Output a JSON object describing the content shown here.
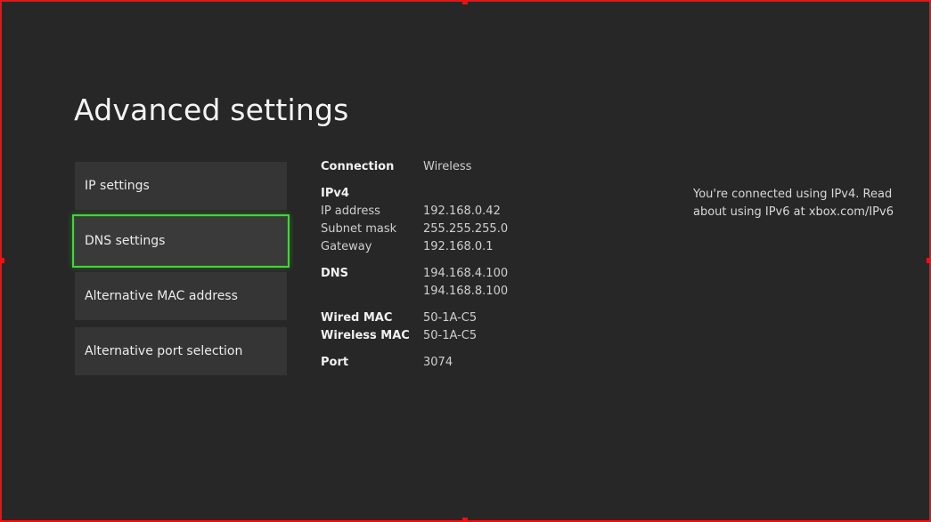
{
  "page": {
    "title": "Advanced settings"
  },
  "menu": {
    "items": [
      {
        "label": "IP settings"
      },
      {
        "label": "DNS settings"
      },
      {
        "label": "Alternative MAC address"
      },
      {
        "label": "Alternative port selection"
      }
    ],
    "focused_index": 1
  },
  "info": {
    "connection_label": "Connection",
    "connection_value": "Wireless",
    "ipv4_label": "IPv4",
    "ip_address_label": "IP address",
    "ip_address_value": "192.168.0.42",
    "subnet_mask_label": "Subnet mask",
    "subnet_mask_value": "255.255.255.0",
    "gateway_label": "Gateway",
    "gateway_value": "192.168.0.1",
    "dns_label": "DNS",
    "dns_primary": "194.168.4.100",
    "dns_secondary": "194.168.8.100",
    "wired_mac_label": "Wired MAC",
    "wired_mac_value": "50-1A-C5",
    "wireless_mac_label": "Wireless MAC",
    "wireless_mac_value": "50-1A-C5",
    "port_label": "Port",
    "port_value": "3074"
  },
  "note": {
    "text": "You're connected using IPv4. Read about using IPv6 at xbox.com/IPv6"
  },
  "colors": {
    "background": "#272727",
    "tile": "#353535",
    "focus": "#44d33a",
    "frame": "#ee1111"
  }
}
